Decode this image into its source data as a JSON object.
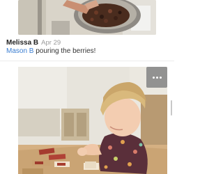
{
  "previous_post": {
    "photo_alt": "Child pouring dark berries into a metal bowl"
  },
  "post": {
    "author": "Melissa B",
    "date": "Apr 29",
    "tagged_child": "Mason B",
    "caption_text": " pouring the berries!"
  },
  "next_post": {
    "photo_alt": "Child arranging number cards on a wooden table",
    "more_menu_icon": "more-horizontal-icon"
  },
  "colors": {
    "link": "#3b7ed1",
    "author": "#222222",
    "date": "#9a9a9a"
  }
}
